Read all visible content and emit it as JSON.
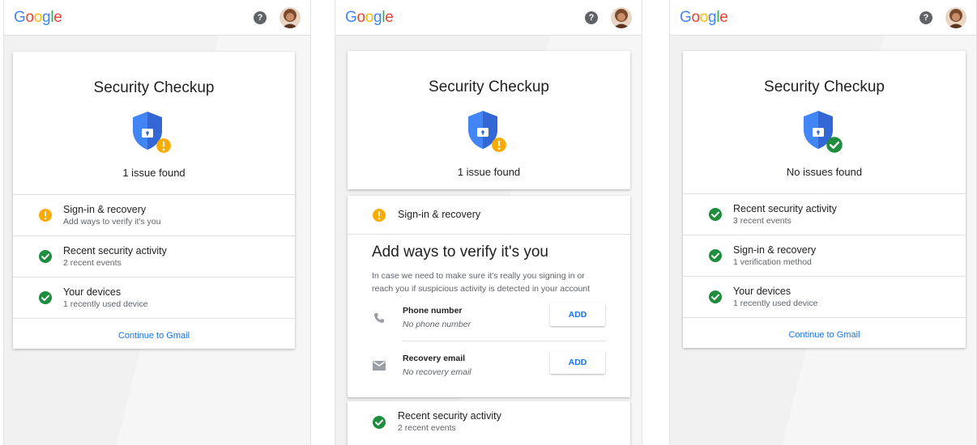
{
  "brand": {
    "logo_letters": [
      "G",
      "o",
      "o",
      "g",
      "l",
      "e"
    ],
    "colors": {
      "blue": "#4285f4",
      "red": "#ea4335",
      "yellow": "#fbbc05",
      "green": "#34a853",
      "link": "#1a73e8",
      "warning": "#f9ab00",
      "ok": "#1e8e3e"
    }
  },
  "header": {
    "help_icon": "help-icon",
    "help_symbol": "?",
    "avatar_icon": "user-avatar"
  },
  "panel_left": {
    "title": "Security Checkup",
    "status": "1 issue found",
    "items": [
      {
        "title": "Sign-in & recovery",
        "subtitle": "Add ways to verify it's you",
        "status": "warning"
      },
      {
        "title": "Recent security activity",
        "subtitle": "2 recent events",
        "status": "ok"
      },
      {
        "title": "Your devices",
        "subtitle": "1 recently used device",
        "status": "ok"
      }
    ],
    "cta": "Continue to Gmail"
  },
  "panel_middle": {
    "title": "Security Checkup",
    "status": "1 issue found",
    "section_title": "Sign-in & recovery",
    "detail_heading": "Add ways to verify it's you",
    "detail_text_line1": "In case we need to make sure it's really you signing in or",
    "detail_text_line2": "reach you if suspicious activity is detected in your account",
    "methods": [
      {
        "title": "Phone number",
        "value": "No phone number",
        "button": "ADD",
        "icon": "phone-icon"
      },
      {
        "title": "Recovery email",
        "value": "No recovery email",
        "button": "ADD",
        "icon": "mail-icon"
      }
    ],
    "next_item": {
      "title": "Recent security activity",
      "subtitle": "2 recent events",
      "status": "ok"
    }
  },
  "panel_right": {
    "title": "Security Checkup",
    "status": "No issues found",
    "items": [
      {
        "title": "Recent security activity",
        "subtitle": "3 recent events",
        "status": "ok"
      },
      {
        "title": "Sign-in & recovery",
        "subtitle": "1 verification method",
        "status": "ok"
      },
      {
        "title": "Your devices",
        "subtitle": "1 recently used device",
        "status": "ok"
      }
    ],
    "cta": "Continue to Gmail"
  }
}
